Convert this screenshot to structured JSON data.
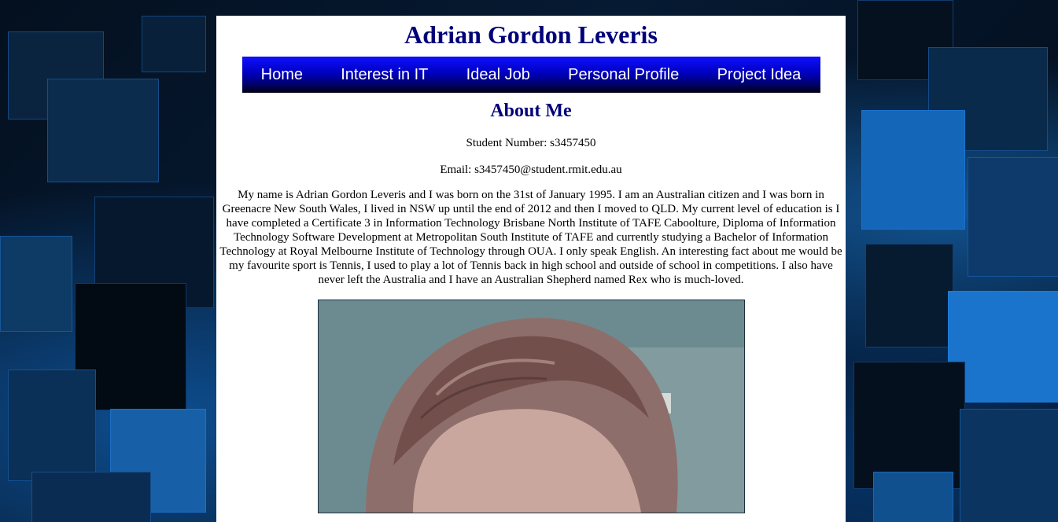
{
  "site": {
    "title": "Adrian Gordon Leveris"
  },
  "nav": {
    "items": [
      {
        "label": "Home"
      },
      {
        "label": "Interest in IT"
      },
      {
        "label": "Ideal Job"
      },
      {
        "label": "Personal Profile"
      },
      {
        "label": "Project Idea"
      }
    ]
  },
  "about": {
    "heading": "About Me",
    "student_number": "Student Number: s3457450",
    "email": "Email: s3457450@student.rmit.edu.au",
    "bio": "My name is Adrian Gordon Leveris and I was born on the 31st of January 1995. I am an Australian citizen and I was born in Greenacre New South Wales, I lived in NSW up until the end of 2012 and then I moved to QLD. My current level of education is I have completed a Certificate 3 in Information Technology Brisbane North Institute of TAFE Caboolture, Diploma of Information Technology Software Development at Metropolitan South Institute of TAFE and currently studying a Bachelor of Information Technology at Royal Melbourne Institute of Technology through OUA. I only speak English. An interesting fact about me would be my favourite sport is Tennis, I used to play a lot of Tennis back in high school and outside of school in competitions. I also have never left the Australia and I have an Australian Shepherd named Rex who is much-loved."
  },
  "colors": {
    "heading": "#00007a",
    "nav_top": "#1010ff",
    "nav_bottom": "#000010",
    "background_accent": "#1478dc"
  }
}
